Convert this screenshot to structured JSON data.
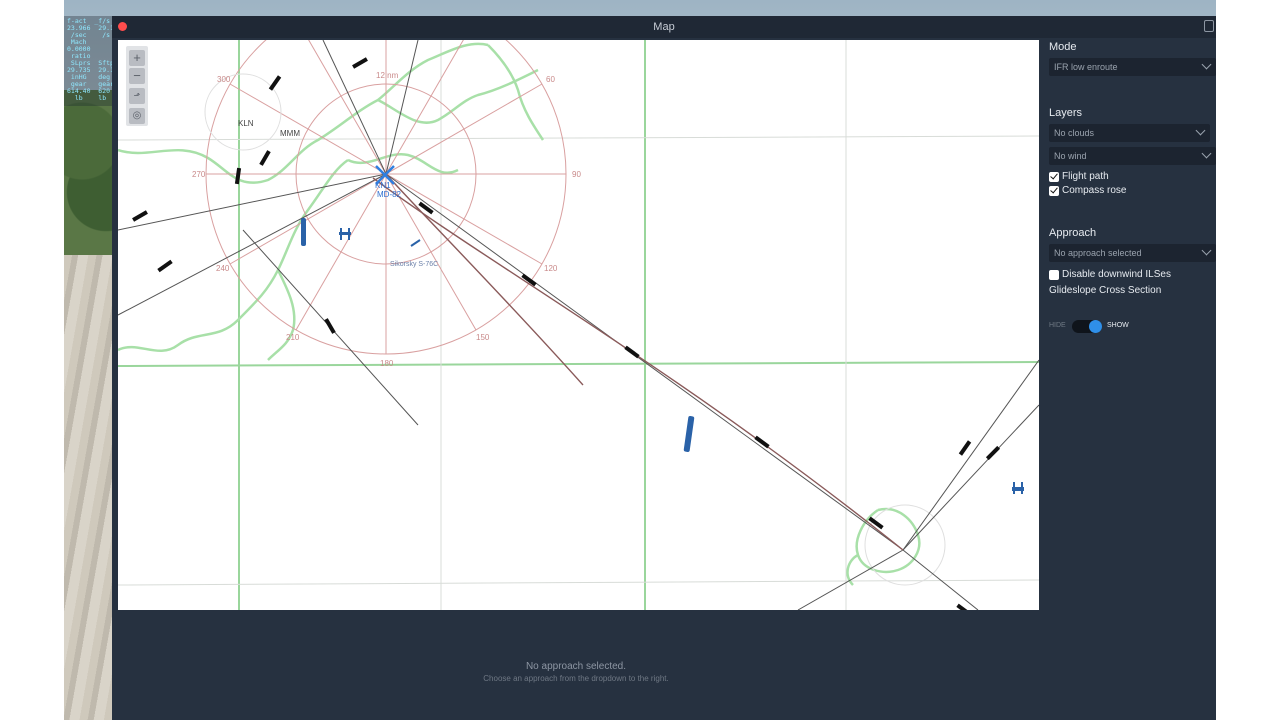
{
  "hud": {
    "lines": [
      "f-act  _f/s",
      "23.966  29.1",
      " /sec    /s",
      " Mach",
      "0.0000",
      " ratio",
      " SLprs  Sftp",
      "29.735  29.1",
      " inHG   deg",
      " gear   gear",
      "614.40  620",
      "  lb    lb"
    ]
  },
  "window": {
    "title": "Map"
  },
  "map": {
    "zoom_in_label": "+",
    "zoom_out_label": "−",
    "labels": {
      "rose_300": "300",
      "rose_60": "60",
      "rose_90": "90",
      "rose_120": "120",
      "rose_150": "150",
      "rose_180": "180",
      "rose_210": "210",
      "rose_240": "240",
      "rose_270": "270",
      "ring_12nm": "12 nm",
      "fix_kln": "KLN",
      "fix_mmm": "MMM",
      "aircraft_id": "KN1",
      "aircraft_alt": "MD-82",
      "heli_label": "Sikorsky S-76C"
    }
  },
  "panel": {
    "mode_label": "Mode",
    "mode_value": "IFR low enroute",
    "layers_label": "Layers",
    "clouds_value": "No clouds",
    "wind_value": "No wind",
    "flight_path_label": "Flight path",
    "flight_path_checked": true,
    "compass_rose_label": "Compass rose",
    "compass_rose_checked": true,
    "approach_label": "Approach",
    "approach_value": "No approach selected",
    "disable_ils_label": "Disable downwind ILSes",
    "disable_ils_checked": false,
    "glideslope_label": "Glideslope Cross Section",
    "hide_label": "HIDE",
    "show_label": "SHOW",
    "glideslope_show": true
  },
  "bottom": {
    "message": "No approach selected.",
    "sub": "Choose an approach from the dropdown to the right."
  },
  "colors": {
    "accent": "#2f8fe8",
    "window_bg": "#263140",
    "coastline": "#9fdca0",
    "grid": "#8fcf92",
    "compass_rose": "#d9a0a0"
  }
}
